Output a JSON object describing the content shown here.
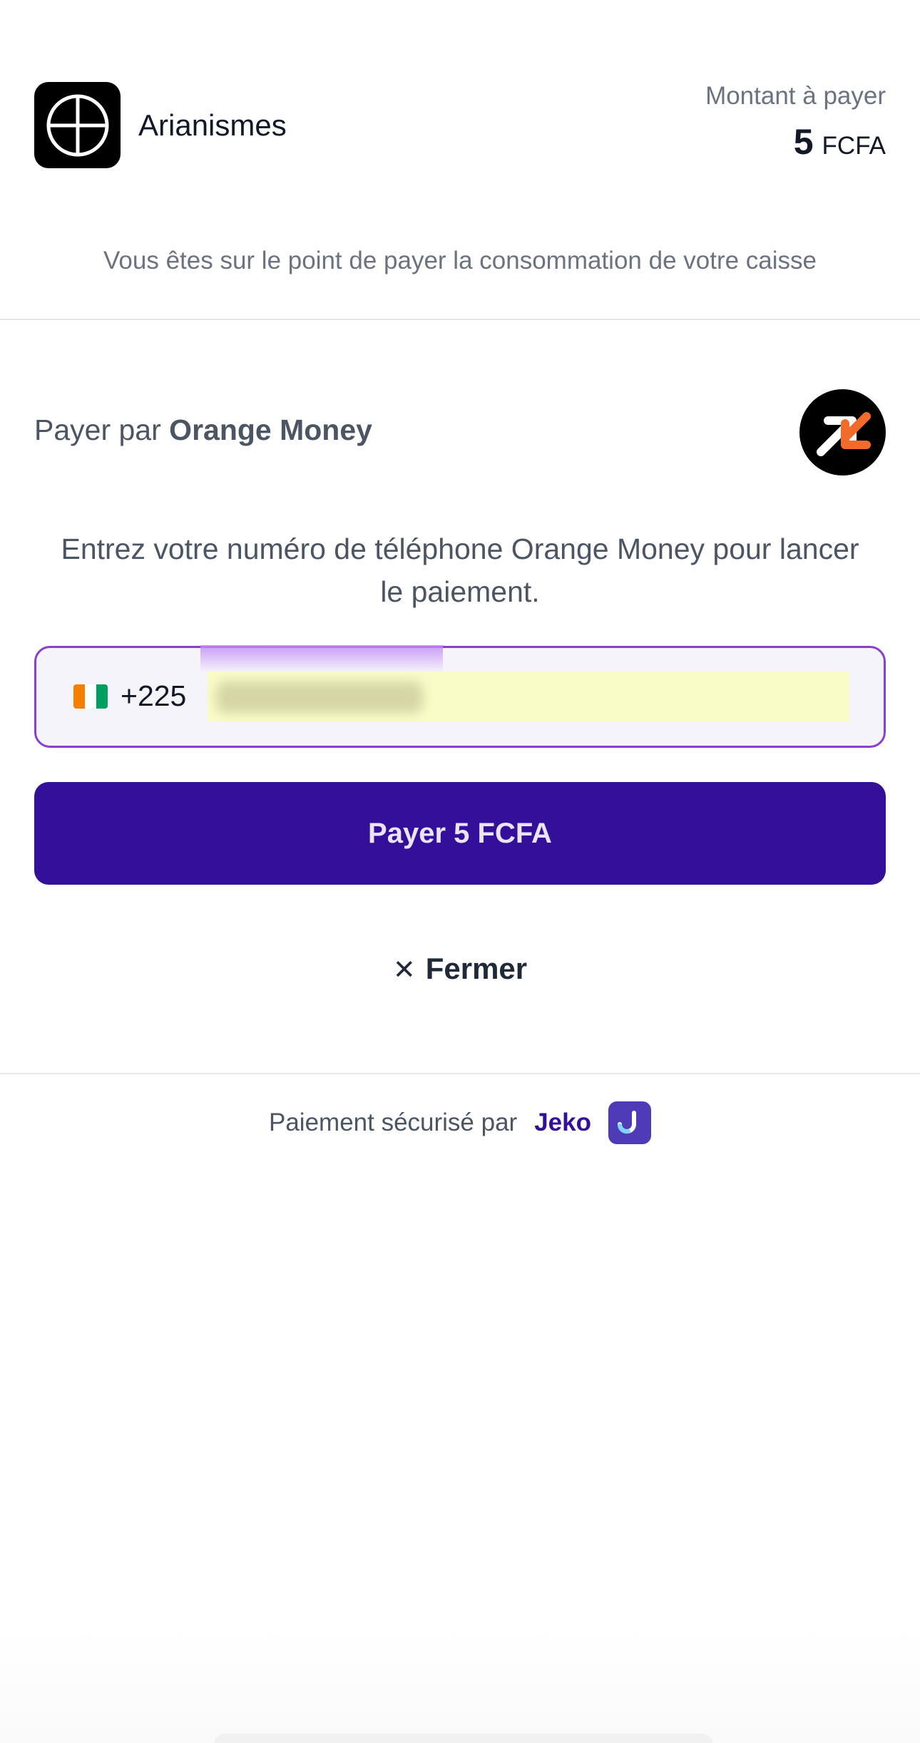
{
  "merchant": {
    "name": "Arianismes",
    "logo_icon": "circle-cross-logo-icon"
  },
  "amount": {
    "label": "Montant à payer",
    "value": "5",
    "currency": "FCFA"
  },
  "subtitle": "Vous êtes sur le point de payer la consommation de votre caisse",
  "method": {
    "prefix": "Payer par",
    "name": "Orange Money",
    "logo_icon": "orange-money-arrows-icon"
  },
  "instructions": "Entrez votre numéro de téléphone Orange Money pour lancer le paiement.",
  "phone": {
    "flag_icon": "cote-divoire-flag-icon",
    "dial_code": "+225",
    "value": ""
  },
  "pay_button": {
    "label": "Payer 5 FCFA"
  },
  "close": {
    "icon": "close-icon",
    "label": "Fermer"
  },
  "footer": {
    "text": "Paiement sécurisé par",
    "brand": "Jeko",
    "logo_icon": "jeko-logo-icon"
  },
  "colors": {
    "primary": "#34109a",
    "focus_border": "#8b3fd1",
    "orange": "#f26b2a",
    "text_muted": "#6b7280"
  }
}
